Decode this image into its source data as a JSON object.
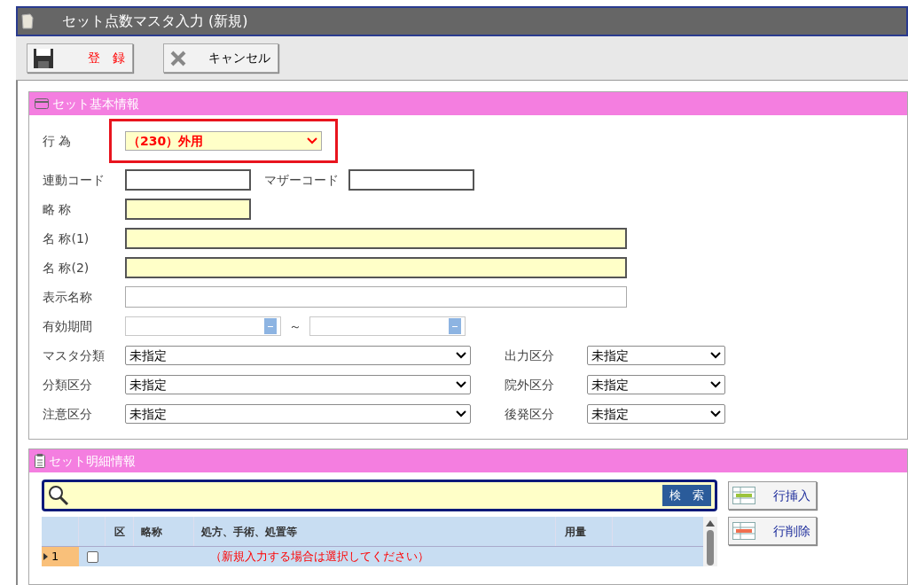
{
  "window": {
    "title": "セット点数マスタ入力 (新規)"
  },
  "toolbar": [
    {
      "label": "登　録",
      "kind": "save"
    },
    {
      "label": "キャンセル",
      "kind": "cancel"
    }
  ],
  "basic_info": {
    "title": "セット基本情報",
    "action": {
      "label": "行 為",
      "value": "（230）外用",
      "highlighted": true
    },
    "codes": [
      {
        "label": "連動コード"
      },
      {
        "label": "マザーコード"
      }
    ],
    "text_fields": [
      {
        "label": "略 称",
        "required": true,
        "kind": "short"
      },
      {
        "label": "名 称(1)",
        "required": true,
        "kind": "long"
      },
      {
        "label": "名 称(2)",
        "required": true,
        "kind": "long"
      },
      {
        "label": "表示名称",
        "required": false,
        "kind": "long"
      }
    ],
    "period": {
      "label": "有効期間",
      "separator": "～"
    },
    "selects": [
      [
        {
          "label": "マスタ分類",
          "value": "未指定"
        },
        {
          "label": "出力区分",
          "value": "未指定"
        }
      ],
      [
        {
          "label": "分類区分",
          "value": "未指定"
        },
        {
          "label": "院外区分",
          "value": "未指定"
        }
      ],
      [
        {
          "label": "注意区分",
          "value": "未指定"
        },
        {
          "label": "後発区分",
          "value": "未指定"
        }
      ]
    ]
  },
  "detail": {
    "title": "セット明細情報",
    "search_button": "検　索",
    "row_buttons": [
      {
        "label": "行挿入",
        "kind": "insert"
      },
      {
        "label": "行削除",
        "kind": "delete"
      }
    ],
    "columns": [
      "区",
      "略称",
      "処方、手術、処置等",
      "用量"
    ],
    "rows": [
      {
        "number": "1",
        "checked": false,
        "selected": true,
        "note": "（新規入力する場合は選択してください）"
      }
    ]
  }
}
